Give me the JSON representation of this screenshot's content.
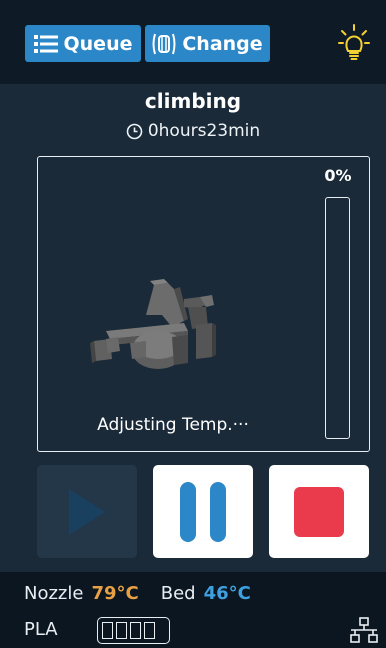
{
  "topbar": {
    "queue_label": "Queue",
    "queue_icon": "list-icon",
    "change_label": "Change",
    "change_icon": "filament-change-icon",
    "light_icon": "lightbulb-icon"
  },
  "job": {
    "name": "climbing",
    "time_icon": "clock-icon",
    "time": "0hours23min"
  },
  "preview": {
    "progress_text": "0%",
    "progress_value": 0,
    "status": "Adjusting Temp.···"
  },
  "controls": {
    "play_icon": "play-icon",
    "pause_icon": "pause-icon",
    "stop_icon": "stop-icon"
  },
  "footer": {
    "nozzle_label": "Nozzle",
    "nozzle_temp": "79°C",
    "bed_label": "Bed",
    "bed_temp": "46°C",
    "filament": "PLA",
    "network_icon": "network-icon"
  },
  "colors": {
    "background": "#1b2a38",
    "topbar": "#0e1a25",
    "accent": "#2b87c8",
    "nozzle_temp": "#e8a045",
    "bed_temp": "#3fa0e0",
    "stop_red": "#ea3b4c",
    "light_bulb": "#f5d033"
  }
}
